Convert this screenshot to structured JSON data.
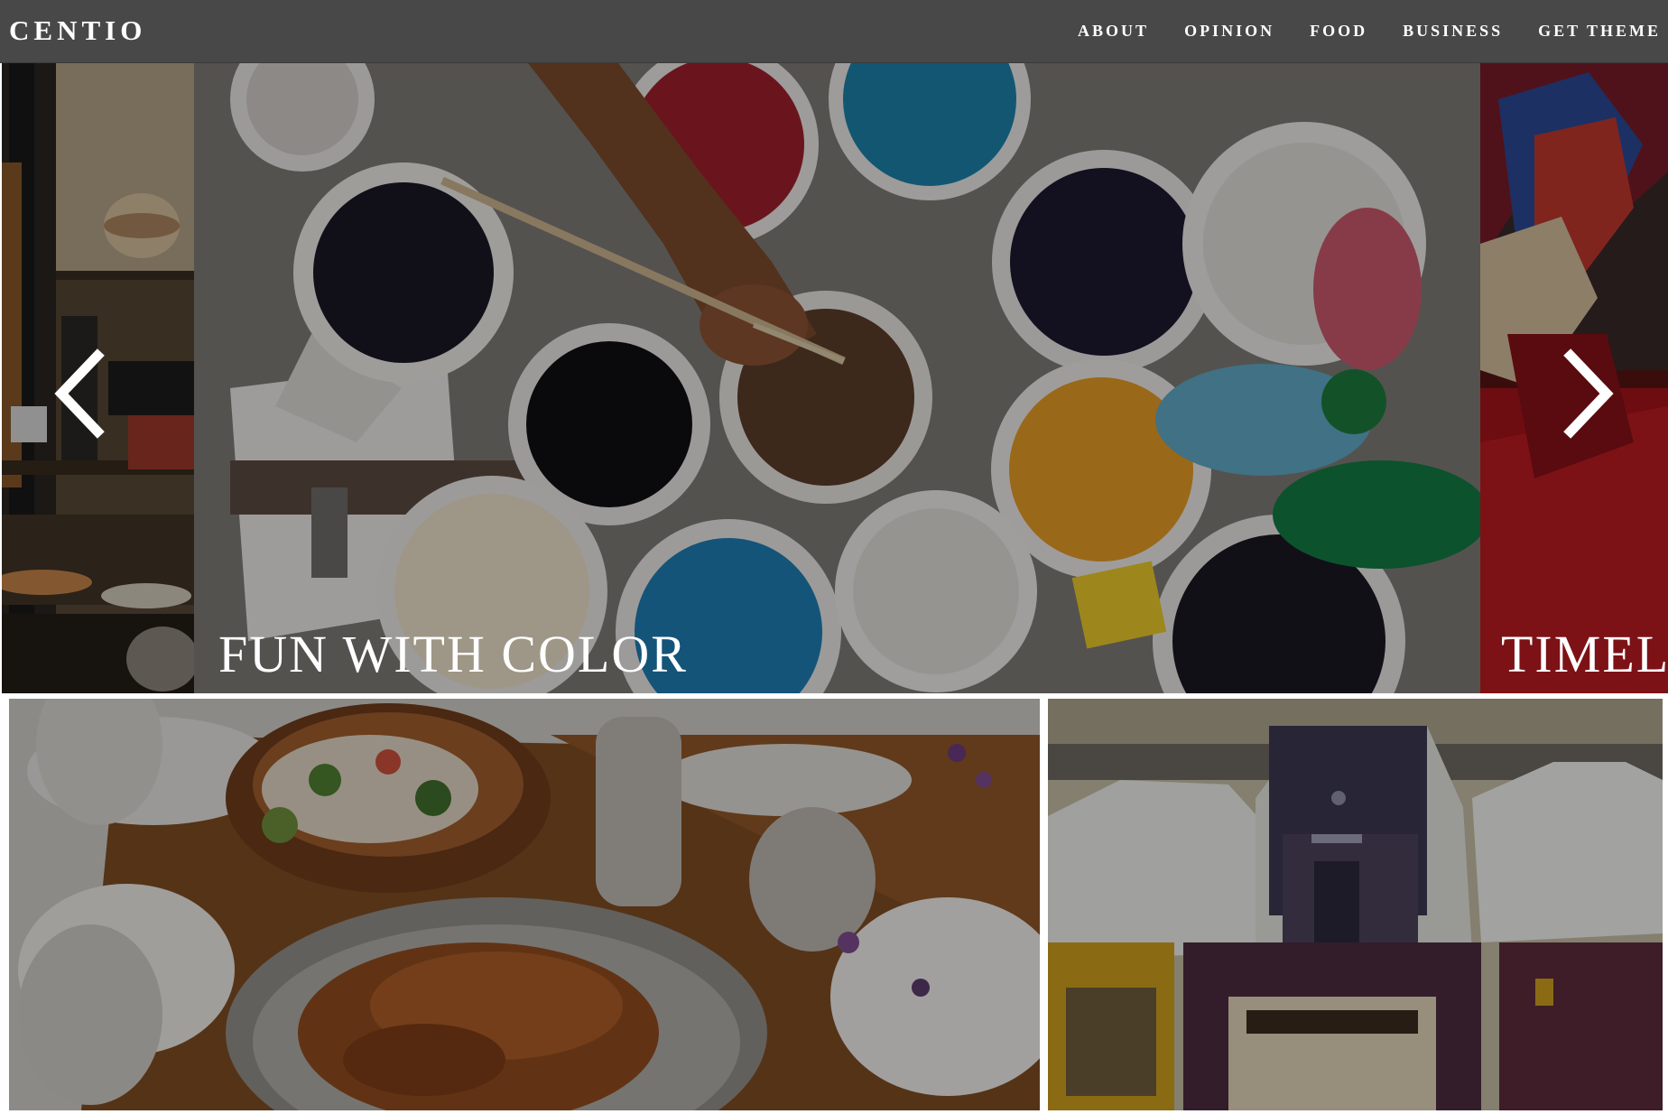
{
  "site": {
    "logo": "CENTIO"
  },
  "nav": {
    "items": [
      {
        "label": "ABOUT"
      },
      {
        "label": "OPINION"
      },
      {
        "label": "FOOD"
      },
      {
        "label": "BUSINESS"
      },
      {
        "label": "GET THEME"
      }
    ]
  },
  "slider": {
    "current": {
      "title": "FUN WITH COLOR"
    },
    "next": {
      "title": "TIMELI"
    },
    "prev_icon": "chevron-left-icon",
    "next_icon": "chevron-right-icon"
  },
  "colors": {
    "header_bg": "#484848",
    "overlay": "rgba(0,0,0,0.35)"
  }
}
